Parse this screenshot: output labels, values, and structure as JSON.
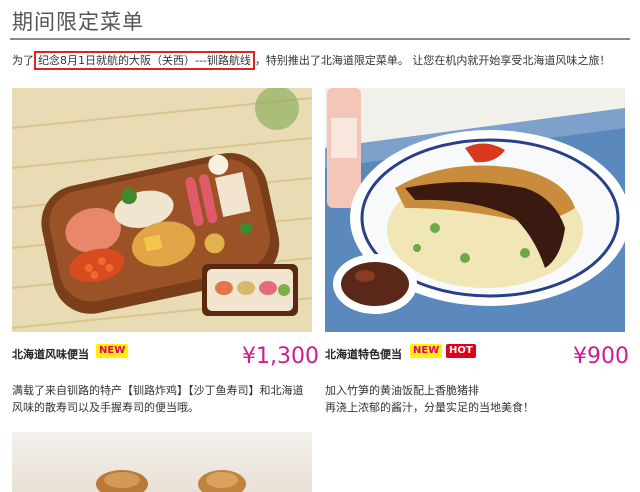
{
  "page": {
    "title": "期间限定菜单"
  },
  "intro": {
    "prefix": "为了",
    "highlight": "纪念8月1日就航的大阪（关西）---钏路航线",
    "suffix": "，特别推出了北海道限定菜单。 让您在机内就开始享受北海道风味之旅！"
  },
  "items": [
    {
      "name": "北海道风味便当",
      "badges": [
        "NEW"
      ],
      "price": "¥1,300",
      "desc_line1": "满载了来自钏路的特产【钏路炸鸡】【沙丁鱼寿司】和北海道",
      "desc_line2": "风味的散寿司以及手握寿司的便当哦。"
    },
    {
      "name": "北海道特色便当",
      "badges": [
        "NEW",
        "HOT"
      ],
      "price": "¥900",
      "desc_line1": "加入竹笋的黄油饭配上香脆猪排",
      "desc_line2": "再浇上浓郁的酱汁，分量实足的当地美食！"
    }
  ],
  "colors": {
    "price": "#cc1d8e",
    "badge_new_bg": "#fff200",
    "badge_hot_bg": "#e0001a",
    "highlight_border": "#dd2222"
  }
}
